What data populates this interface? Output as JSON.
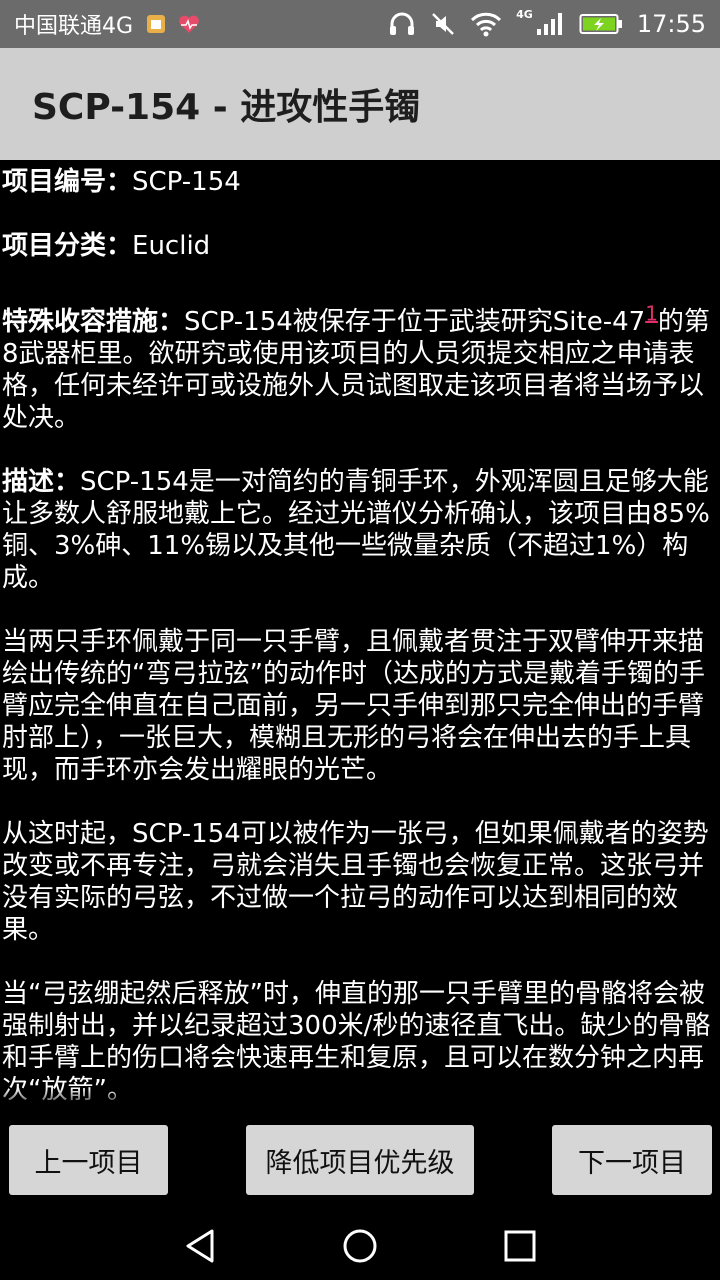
{
  "status_bar": {
    "carrier": "中国联通4G",
    "network": "4G",
    "time": "17:55",
    "icons": [
      "notification-app-icon",
      "heart-app-icon",
      "headphones-icon",
      "mute-icon",
      "wifi-icon",
      "signal-icon",
      "battery-charging-icon"
    ]
  },
  "header": {
    "title": "SCP-154 - 进攻性手镯"
  },
  "article": {
    "item_number_label": "项目编号：",
    "item_number": "SCP-154",
    "object_class_label": "项目分类：",
    "object_class": "Euclid",
    "containment_label": "特殊收容措施：",
    "containment_text_a": "SCP-154被保存于位于武装研究Site-47",
    "containment_footnote": "1",
    "containment_text_b": "的第8武器柜里。欲研究或使用该项目的人员须提交相应之申请表格，任何未经许可或设施外人员试图取走该项目者将当场予以处决。",
    "description_label": "描述：",
    "description_text": "SCP-154是一对简约的青铜手环，外观浑圆且足够大能让多数人舒服地戴上它。经过光谱仪分析确认，该项目由85%铜、3%砷、11%锡以及其他一些微量杂质（不超过1%）构成。",
    "para_1": "当两只手环佩戴于同一只手臂，且佩戴者贯注于双臂伸开来描绘出传统的“弯弓拉弦”的动作时（达成的方式是戴着手镯的手臂应完全伸直在自己面前，另一只手伸到那只完全伸出的手臂肘部上），一张巨大，模糊且无形的弓将会在伸出去的手上具现，而手环亦会发出耀眼的光芒。",
    "para_2": "从这时起，SCP-154可以被作为一张弓，但如果佩戴者的姿势改变或不再专注，弓就会消失且手镯也会恢复正常。这张弓并没有实际的弓弦，不过做一个拉弓的动作可以达到相同的效果。",
    "para_3": "当“弓弦绷起然后释放”时，伸直的那一只手臂里的骨骼将会被强制射出，并以纪录超过300米/秒的速径直飞出。缺少的骨骼和手臂上的伤口将会快速再生和复原，且可以在数分钟之内再次“放箭”。"
  },
  "buttons": {
    "prev": "上一项目",
    "lower_priority": "降低项目优先级",
    "next": "下一项目"
  },
  "nav_bar": {
    "icons": [
      "back-triangle-icon",
      "home-circle-icon",
      "recents-square-icon"
    ]
  }
}
